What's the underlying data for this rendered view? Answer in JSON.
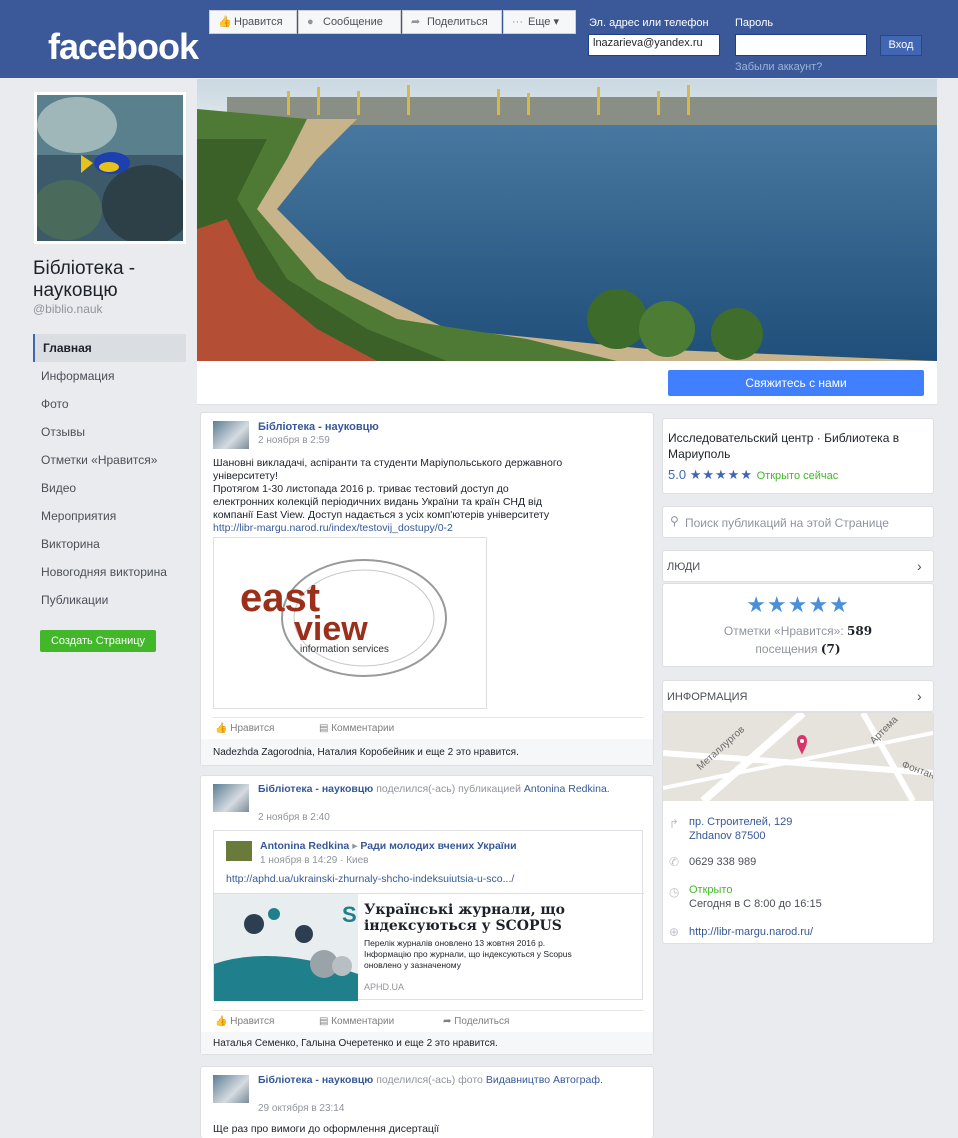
{
  "header": {
    "logo": "facebook",
    "email_label": "Эл. адрес или телефон",
    "password_label": "Пароль",
    "email_value": "lnazarieva@yandex.ru",
    "login_button": "Вход",
    "forgot_link": "Забыли аккаунт?"
  },
  "page": {
    "name": "Бібліотека - науковцю",
    "handle": "@biblio.nauk"
  },
  "nav": {
    "items": [
      "Главная",
      "Информация",
      "Фото",
      "Отзывы",
      "Отметки «Нравится»",
      "Видео",
      "Мероприятия",
      "Викторина",
      "Новогодняя викторина",
      "Публикации"
    ],
    "create_page": "Создать Страницу"
  },
  "actions": {
    "like": "Нравится",
    "message": "Сообщение",
    "share": "Поделиться",
    "more": "Еще",
    "contact": "Свяжитесь с нами"
  },
  "post1": {
    "author": "Бібліотека - науковцю",
    "time": "2 ноября в 2:59",
    "text_line1": "Шановні викладачі, аспіранти та студенти Маріупольського державного",
    "text_line2": "університету!",
    "text_line3": "Протягом 1-30 листопада 2016 р. триває тестовий доступ до",
    "text_line4": "електронних колекцій періодичних видань України та країн СНД від",
    "text_line5": "компанії East View. Доступ надається з усіх комп'ютерів університету",
    "link": "http://libr-margu.narod.ru/index/testovij_dostupy/0-2",
    "logo_word1": "east",
    "logo_word2": "view",
    "logo_sub": "information services",
    "like": "Нравится",
    "comment": "Комментарии",
    "likes_line": "Nadezhda Zagorodnia, Наталия Коробейник и еще 2 это нравится."
  },
  "post2": {
    "author": "Бібліотека - науковцю",
    "shared": "поделился(-ась) публикацией",
    "shared_author": "Antonina Redkina.",
    "time": "2 ноября в 2:40",
    "inner_author": "Antonina Redkina",
    "inner_arrow": "▸",
    "inner_group": "Ради молодих вчених України",
    "inner_time": "1 ноября в 14:29 · Киев",
    "inner_link": "http://aphd.ua/ukrainski-zhurnaly-shcho-indeksuiutsia-u-sco.../",
    "preview_title_line1": "Українські журнали, що",
    "preview_title_line2": "індексуються у SCOPUS",
    "preview_desc_line1": "Перелік журналів оновлено 13 жовтня 2016 р.",
    "preview_desc_line2": "Інформацію про журнали, що індексуються у Scopus",
    "preview_desc_line3": "оновлено у зазначеному",
    "preview_domain": "APHD.UA",
    "like": "Нравится",
    "comment": "Комментарии",
    "share": "Поделиться",
    "likes_line": "Наталья Семенко, Галына Очеретенко и еще 2 это нравится."
  },
  "post3": {
    "author": "Бібліотека - науковцю",
    "shared": "поделился(-ась) фото",
    "shared_from": "Видавництво Автограф.",
    "time": "29 октября в 23:14",
    "text": "Ще раз про вимоги до оформлення дисертації"
  },
  "sidebar": {
    "category": "Исследовательский центр · Библиотека в Мариуполь",
    "rating": "5.0",
    "stars": "★★★★★",
    "open_now": "Открыто сейчас",
    "search_placeholder": "Поиск публикаций на этой Странице",
    "people_title": "Люди",
    "people_stars": "★★★★★",
    "likes_label": "Отметки «Нравится»:",
    "likes_count": "589",
    "visits_label": "посещения",
    "visits_count": "(7)",
    "info_title": "Информация",
    "map_street1": "Металлургов",
    "map_street2": "Артема",
    "map_street3": "Фонтан",
    "address_line1": "пр. Строителей, 129",
    "address_line2": "Zhdanov 87500",
    "phone": "0629 338 989",
    "open": "Открыто",
    "hours": "Сегодня в С 8:00 до 16:15",
    "website": "http://libr-margu.narod.ru/"
  },
  "colors": {
    "brand": "#3b5998",
    "link": "#365899",
    "contact_button": "#4080ff",
    "create_button": "#42b72a"
  }
}
